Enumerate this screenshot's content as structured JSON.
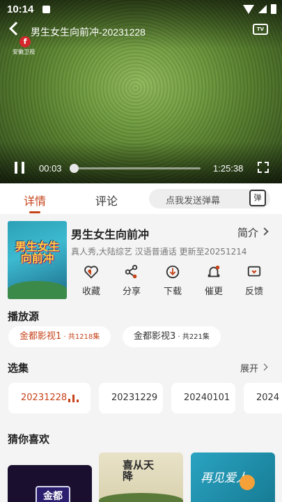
{
  "status": {
    "time": "10:14"
  },
  "player": {
    "title": "男生女生向前冲-20231228",
    "channel_logo_text": "安徽卫视",
    "channel_logo_glyph": "f",
    "tv_icon_label": "TV",
    "current_time": "00:03",
    "duration": "1:25:38",
    "progress": 0.01
  },
  "tabs": [
    {
      "label": "详情",
      "active": true
    },
    {
      "label": "评论",
      "active": false
    }
  ],
  "danmu": {
    "placeholder": "点我发送弹幕",
    "button_label": "弹"
  },
  "show": {
    "poster_text": "男生女生向前冲",
    "title": "男生女生向前冲",
    "intro_label": "简介",
    "meta": "真人秀,大陆综艺 汉语普通话 更新至20251214"
  },
  "actions": [
    {
      "label": "收藏",
      "icon": "heart-icon"
    },
    {
      "label": "分享",
      "icon": "share-icon"
    },
    {
      "label": "下载",
      "icon": "download-icon"
    },
    {
      "label": "催更",
      "icon": "bell-icon"
    },
    {
      "label": "反馈",
      "icon": "feedback-icon"
    }
  ],
  "sources": {
    "title": "播放源",
    "items": [
      {
        "name": "金都影视1",
        "count": " · 共1218集",
        "active": true
      },
      {
        "name": "金都影视3",
        "count": " · 共221集",
        "active": false
      }
    ]
  },
  "episodes": {
    "title": "选集",
    "expand_label": "展开",
    "items": [
      {
        "label": "20231228",
        "active": true
      },
      {
        "label": "20231229",
        "active": false
      },
      {
        "label": "20240101",
        "active": false
      },
      {
        "label": "2024",
        "active": false
      }
    ]
  },
  "recommend": {
    "title": "猜你喜欢",
    "cards": [
      {
        "text": "金都",
        "color": "#1a0f2e"
      },
      {
        "text": "喜从天降",
        "color": "#e8e2c8"
      },
      {
        "text": "再见爱人",
        "color": "#1e8aa6"
      }
    ]
  },
  "colors": {
    "accent": "#c6431a"
  }
}
